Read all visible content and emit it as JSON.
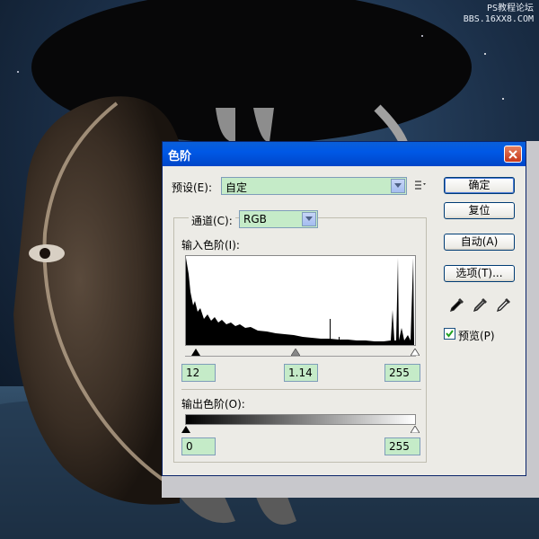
{
  "watermark": {
    "line1": "PS教程论坛",
    "line2": "BBS.16XX8.COM"
  },
  "dialog": {
    "title": "色阶",
    "preset_label": "预设(E):",
    "preset_value": "自定",
    "channel_label": "通道(C):",
    "channel_value": "RGB",
    "input_levels_label": "输入色阶(I):",
    "input_black": "12",
    "input_gamma": "1.14",
    "input_white": "255",
    "output_levels_label": "输出色阶(O):",
    "output_black": "0",
    "output_white": "255",
    "buttons": {
      "ok": "确定",
      "reset": "复位",
      "auto": "自动(A)",
      "options": "选项(T)..."
    },
    "preview_label": "预览(P)",
    "preview_checked": true
  },
  "icons": [
    "close-icon",
    "dropdown-arrow-icon",
    "preset-menu-icon",
    "black-eyedropper-icon",
    "gray-eyedropper-icon",
    "white-eyedropper-icon",
    "checkmark-icon"
  ]
}
